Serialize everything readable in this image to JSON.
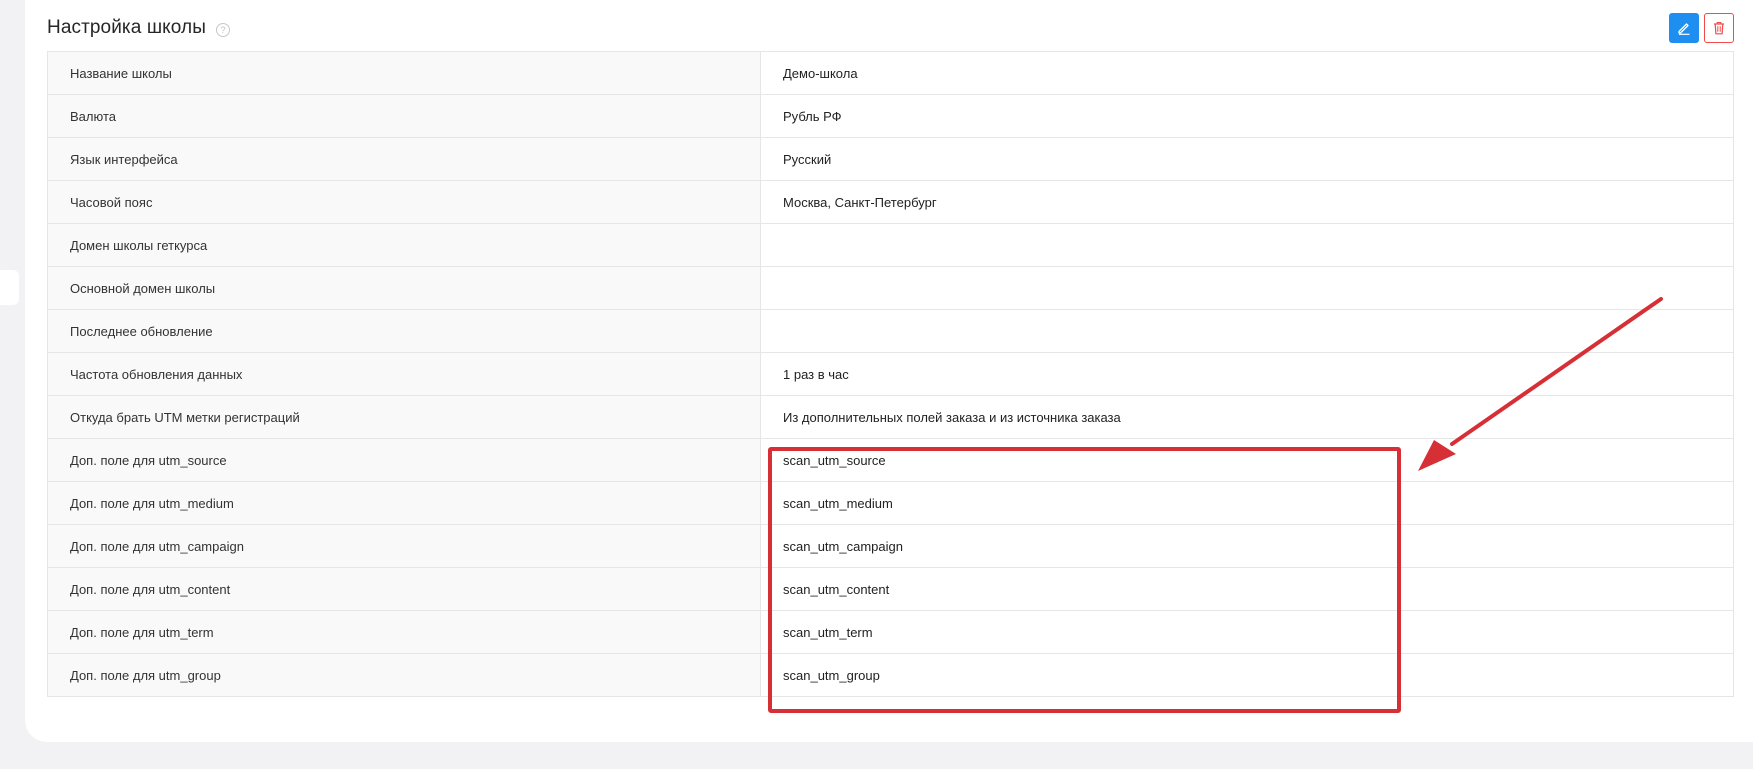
{
  "section": {
    "title": "Настройка школы",
    "help_icon": "question-circle-icon"
  },
  "actions": {
    "edit_icon": "pencil-icon",
    "delete_icon": "trash-icon",
    "edit_color": "#1e8ef0",
    "delete_color": "#f04a4a"
  },
  "settings": [
    {
      "label": "Название школы",
      "value": "Демо-школа"
    },
    {
      "label": "Валюта",
      "value": "Рубль РФ"
    },
    {
      "label": "Язык интерфейса",
      "value": "Русский"
    },
    {
      "label": "Часовой пояс",
      "value": "Москва, Санкт-Петербург"
    },
    {
      "label": "Домен школы геткурса",
      "value": ""
    },
    {
      "label": "Основной домен школы",
      "value": ""
    },
    {
      "label": "Последнее обновление",
      "value": ""
    },
    {
      "label": "Частота обновления данных",
      "value": "1 раз в час"
    },
    {
      "label": "Откуда брать UTM метки регистраций",
      "value": "Из дополнительных полей заказа и из источника заказа"
    },
    {
      "label": "Доп. поле для utm_source",
      "value": "scan_utm_source"
    },
    {
      "label": "Доп. поле для utm_medium",
      "value": "scan_utm_medium"
    },
    {
      "label": "Доп. поле для utm_campaign",
      "value": "scan_utm_campaign"
    },
    {
      "label": "Доп. поле для utm_content",
      "value": "scan_utm_content"
    },
    {
      "label": "Доп. поле для utm_term",
      "value": "scan_utm_term"
    },
    {
      "label": "Доп. поле для utm_group",
      "value": "scan_utm_group"
    }
  ],
  "annotation": {
    "color": "#d62f36",
    "shape": "rectangle-with-arrow"
  }
}
